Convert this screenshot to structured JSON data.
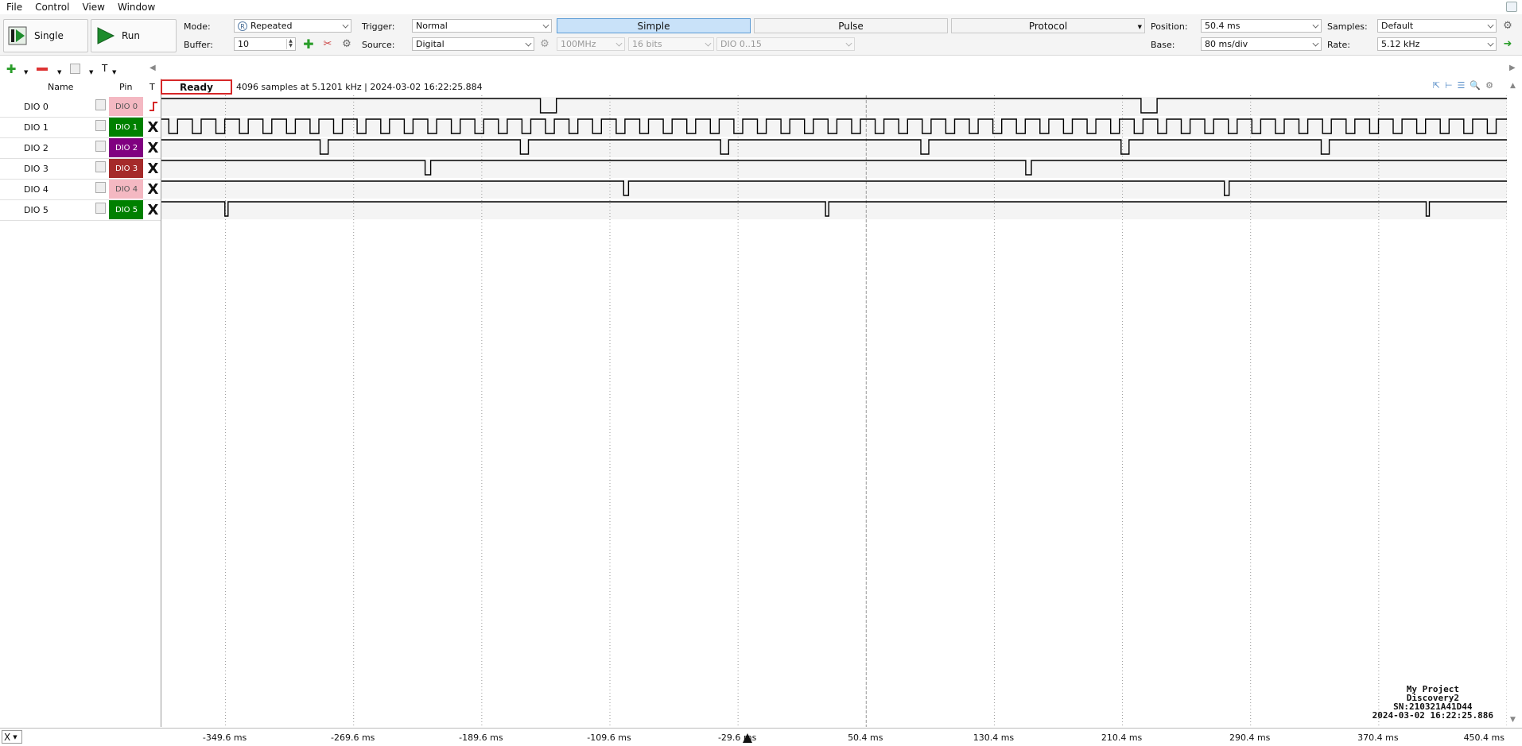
{
  "menu": [
    "File",
    "Control",
    "View",
    "Window"
  ],
  "toolbar": {
    "single_label": "Single",
    "run_label": "Run",
    "mode_label": "Mode:",
    "mode_value": "Repeated",
    "mode_badge": "R",
    "buffer_label": "Buffer:",
    "buffer_value": "10",
    "trigger_label": "Trigger:",
    "trigger_value": "Normal",
    "source_label": "Source:",
    "source_value": "Digital",
    "freq_value": "100MHz",
    "bits_value": "16 bits",
    "dio_range_value": "DIO 0..15",
    "tab_simple": "Simple",
    "tab_pulse": "Pulse",
    "tab_protocol": "Protocol",
    "position_label": "Position:",
    "position_value": "50.4 ms",
    "base_label": "Base:",
    "base_value": "80 ms/div",
    "samples_label": "Samples:",
    "samples_value": "Default",
    "rate_label": "Rate:",
    "rate_value": "5.12 kHz"
  },
  "toolbar2": {
    "text_tool": "T"
  },
  "columns": {
    "name": "Name",
    "pin": "Pin",
    "trigger": "T"
  },
  "channels": [
    {
      "name": "DIO 0",
      "pin": "DIO  0",
      "pin_color": "#f4b8c2",
      "pin_text_color": "#555555",
      "trigger": "rise"
    },
    {
      "name": "DIO 1",
      "pin": "DIO  1",
      "pin_color": "#008000",
      "pin_text_color": "#ffffff",
      "trigger": "X"
    },
    {
      "name": "DIO 2",
      "pin": "DIO  2",
      "pin_color": "#800080",
      "pin_text_color": "#ffffff",
      "trigger": "X"
    },
    {
      "name": "DIO 3",
      "pin": "DIO  3",
      "pin_color": "#a52a2a",
      "pin_text_color": "#ffffff",
      "trigger": "X"
    },
    {
      "name": "DIO 4",
      "pin": "DIO  4",
      "pin_color": "#f4b8c2",
      "pin_text_color": "#555555",
      "trigger": "X"
    },
    {
      "name": "DIO 5",
      "pin": "DIO  5",
      "pin_color": "#008000",
      "pin_text_color": "#ffffff",
      "trigger": "X"
    }
  ],
  "status": {
    "ready": "Ready",
    "info": "4096 samples at 5.1201 kHz | 2024-03-02 16:22:25.884"
  },
  "time_axis": {
    "unit": "ms",
    "range": [
      -389.6,
      450.4
    ],
    "ticks": [
      "-349.6 ms",
      "-269.6 ms",
      "-189.6 ms",
      "-109.6 ms",
      "-29.6 ms",
      "50.4 ms",
      "130.4 ms",
      "210.4 ms",
      "290.4 ms",
      "370.4 ms",
      "450.4 ms"
    ],
    "tick_values": [
      -349.6,
      -269.6,
      -189.6,
      -109.6,
      -29.6,
      50.4,
      130.4,
      210.4,
      290.4,
      370.4,
      450.4
    ],
    "trigger_position": 0
  },
  "waveforms": [
    {
      "channel": "DIO 0",
      "kind": "low_pulses",
      "pulses": [
        [
          -153.0,
          -143.0
        ],
        [
          222.0,
          232.0
        ]
      ]
    },
    {
      "channel": "DIO 1",
      "kind": "clock",
      "start": -385.0,
      "period": 14.7,
      "low_width": 5.5
    },
    {
      "channel": "DIO 2",
      "kind": "low_pulses",
      "pulses": [
        [
          -290.5,
          -285.5
        ],
        [
          -165.5,
          -160.5
        ],
        [
          -40.5,
          -35.5
        ],
        [
          84.5,
          89.5
        ],
        [
          209.5,
          214.5
        ],
        [
          334.5,
          339.5
        ]
      ]
    },
    {
      "channel": "DIO 3",
      "kind": "low_pulses",
      "pulses": [
        [
          -225.0,
          -221.5
        ],
        [
          150.0,
          153.5
        ]
      ]
    },
    {
      "channel": "DIO 4",
      "kind": "low_pulses",
      "pulses": [
        [
          -101.0,
          -98.0
        ],
        [
          274.0,
          277.0
        ]
      ]
    },
    {
      "channel": "DIO 5",
      "kind": "low_pulses",
      "pulses": [
        [
          -350.0,
          -348.0
        ],
        [
          25.0,
          27.0
        ],
        [
          400.0,
          402.0
        ]
      ]
    }
  ],
  "infobox": {
    "line1": "My Project",
    "line2": "Discovery2",
    "line3": "SN:210321A41D44",
    "line4": "2024-03-02 16:22:25.886"
  },
  "bottom": {
    "cursor_mode": "X"
  },
  "colors": {
    "accent_selected_tab": "#c9e2f9",
    "ready_border": "#d62728",
    "trace": "#000000",
    "grid": "#999999"
  }
}
